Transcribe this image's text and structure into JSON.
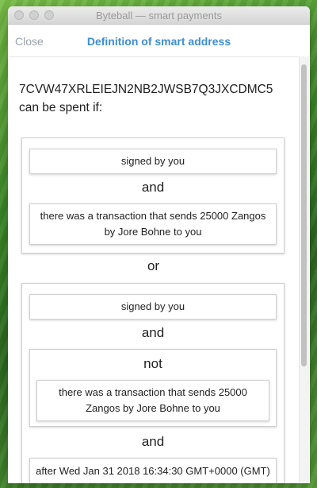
{
  "window": {
    "title": "Byteball — smart payments"
  },
  "navbar": {
    "close_label": "Close",
    "title": "Definition of smart address"
  },
  "definition": {
    "address_line": "7CVW47XRLEIEJN2NB2JWSB7Q3JXCDMC5 can be spent if:",
    "branch1": {
      "cond1": "signed by you",
      "op": "and",
      "cond2": "there was a transaction that sends 25000 Zangos by Jore Bohne to you"
    },
    "or_label": "or",
    "branch2": {
      "cond1": "signed by you",
      "op1": "and",
      "not_label": "not",
      "not_cond": "there was a transaction that sends 25000 Zangos by Jore Bohne to you",
      "op2": "and",
      "cond3": "after Wed Jan 31 2018 16:34:30 GMT+0000 (GMT)"
    }
  }
}
